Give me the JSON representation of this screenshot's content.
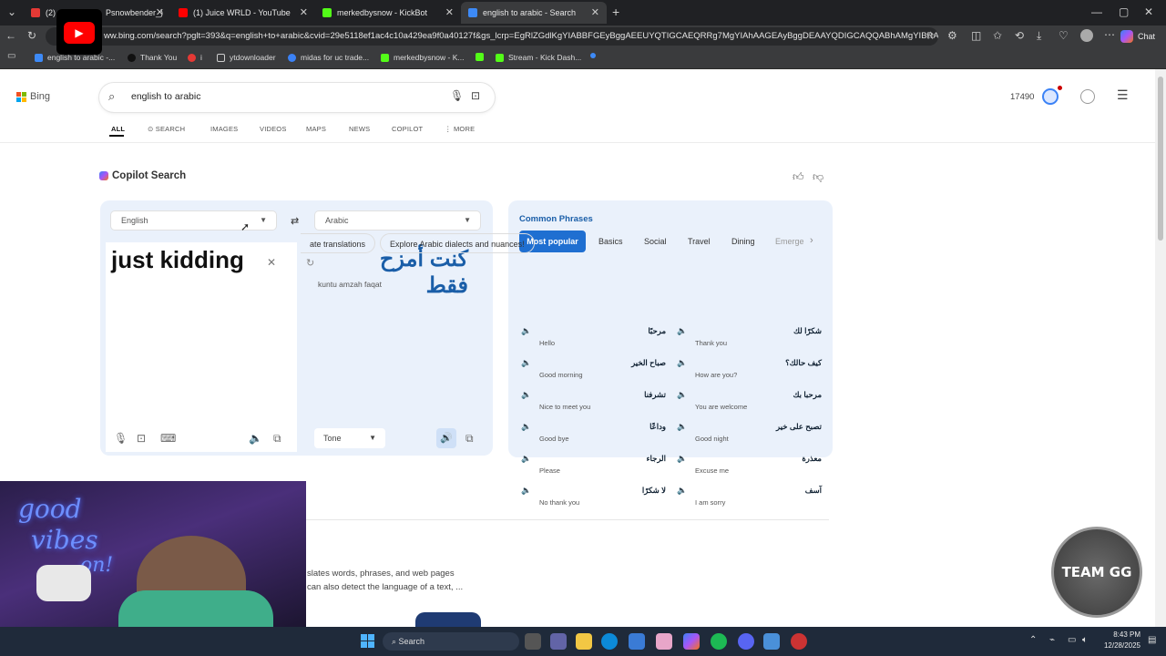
{
  "tabs": [
    {
      "label": "(2)",
      "color": "#e53935"
    },
    {
      "label": "Psnowbender_)",
      "color": "#777"
    },
    {
      "label": "(1) Juice WRLD - YouTube",
      "color": "#ff0000"
    },
    {
      "label": "merkedbysnow - KickBot",
      "color": "#53fc18"
    },
    {
      "label": "english to arabic - Search",
      "color": "#3d8af7"
    }
  ],
  "address": {
    "url": "ww.bing.com/search?pglt=393&q=english+to+arabic&cvid=29e5118ef1ac4c10a429ea9f0a40127f&gs_lcrp=EgRlZGdlKgYIABBFGEyBggAEEUYQTIGCAEQRRg7MgYIAhAAGEAyBggDEAAYQDIGCAQQABhAMgYIBRAAGE..."
  },
  "chrome": {
    "chat": "Chat"
  },
  "bookmarks": [
    "english to arabic -...",
    "Thank You",
    "i",
    "ytdownloader",
    "midas for uc trade...",
    "merkedbysnow - K...",
    "",
    "Stream - Kick Dash...",
    ""
  ],
  "bing": {
    "logo": "Bing",
    "query": "english to arabic",
    "points": "17490"
  },
  "nav": [
    "ALL",
    "SEARCH",
    "IMAGES",
    "VIDEOS",
    "MAPS",
    "NEWS",
    "COPILOT",
    "MORE"
  ],
  "copilot": {
    "title": "Copilot Search"
  },
  "translator": {
    "source_lang": "English",
    "target_lang": "Arabic",
    "input": "just kidding",
    "output": "كنت أمزح فقط",
    "transliteration": "kuntu amzah faqat",
    "tone": "Tone"
  },
  "phrases": {
    "title": "Common Phrases",
    "tabs": [
      "Most popular",
      "Basics",
      "Social",
      "Travel",
      "Dining",
      "Emerge"
    ],
    "items": [
      {
        "ar": "مرحبًا",
        "en": "Hello"
      },
      {
        "ar": "شكرًا لك",
        "en": "Thank you"
      },
      {
        "ar": "صباح الخير",
        "en": "Good morning"
      },
      {
        "ar": "كيف حالك؟",
        "en": "How are you?"
      },
      {
        "ar": "تشرفنا",
        "en": "Nice to meet you"
      },
      {
        "ar": "مرحبا بك",
        "en": "You are welcome"
      },
      {
        "ar": "وداعًا",
        "en": "Good bye"
      },
      {
        "ar": "تصبح على خير",
        "en": "Good night"
      },
      {
        "ar": "الرجاء",
        "en": "Please"
      },
      {
        "ar": "معذرة",
        "en": "Excuse me"
      },
      {
        "ar": "لا شكرًا",
        "en": "No thank you"
      },
      {
        "ar": "آسف",
        "en": "I am sorry"
      }
    ]
  },
  "suggestions": [
    "ate translations",
    "Explore Arabic dialects and nuances!"
  ],
  "snippet": {
    "line1": "slates words, phrases, and web pages",
    "line2": "can also detect the language of a text, ..."
  },
  "overlay": {
    "text1": "good",
    "text2": "vibes",
    "text3": "on!",
    "badge": "TEAM GG"
  },
  "taskbar": {
    "search": "Search",
    "time": "8:43 PM",
    "date": "12/28/2025"
  }
}
